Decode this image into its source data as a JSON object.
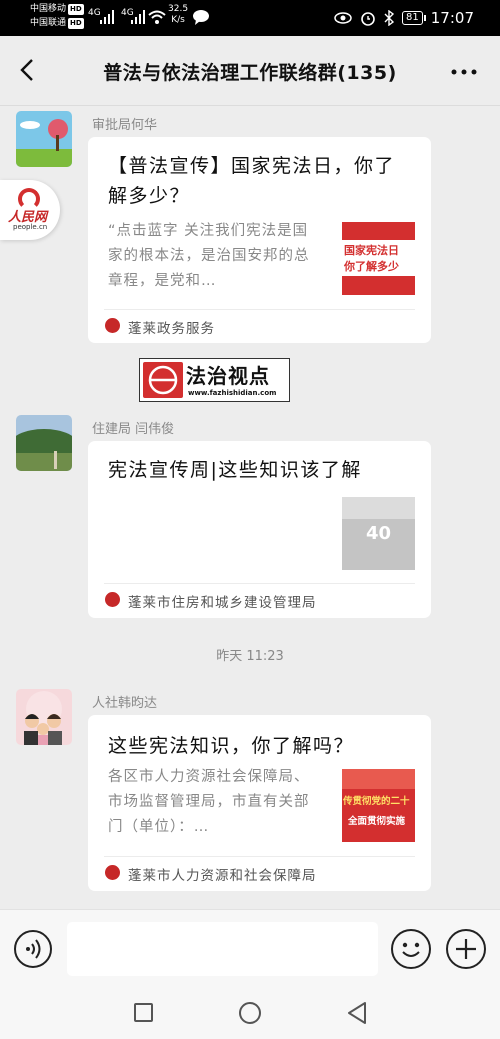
{
  "status_bar": {
    "carrier1": "中国移动",
    "carrier2": "中国联通",
    "hd": "HD",
    "net1": "4G",
    "net2": "4G",
    "speed_value": "32.5",
    "speed_unit": "K/s",
    "battery": "81",
    "time": "17:07"
  },
  "header": {
    "title": "普法与依法治理工作联络群(135)"
  },
  "messages": [
    {
      "sender": "审批局何华",
      "title": "【普法宣传】国家宪法日，你了解多少？",
      "description": "“点击蓝字 关注我们宪法是国家的根本法，是治国安邦的总章程，是党和…",
      "thumbnail_text": [
        "国家宪法日",
        "你了解多少"
      ],
      "source": "蓬莱政务服务"
    },
    {
      "sender": "住建局 闫伟俊",
      "title": "宪法宣传周|这些知识该了解",
      "description": "",
      "thumbnail_text": [
        "40"
      ],
      "source": "蓬莱市住房和城乡建设管理局"
    },
    {
      "sender": "人社韩昀达",
      "title": "这些宪法知识，你了解吗？",
      "description": "各区市人力资源社会保障局、市场监督管理局，市直有关部门（单位）：…",
      "thumbnail_text": [
        "传贯彻党的二十",
        "全面贯彻实施"
      ],
      "source": "蓬莱市人力资源和社会保障局"
    }
  ],
  "timestamp": "昨天 11:23",
  "floating": {
    "people_logo": "人民网",
    "people_url": "people.cn",
    "watermark_title": "法治视点",
    "watermark_url": "www.fazhishidian.com"
  },
  "input": {
    "placeholder": ""
  },
  "colors": {
    "accent_red": "#d32f2f",
    "background": "#ededed"
  }
}
